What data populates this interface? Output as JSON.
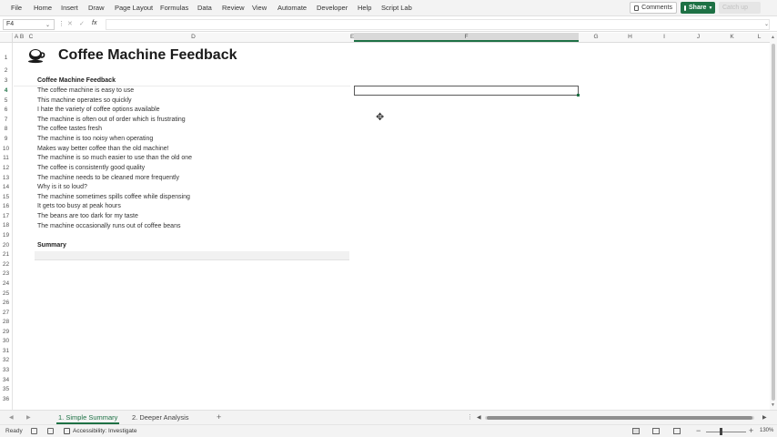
{
  "menu": [
    "File",
    "Home",
    "Insert",
    "Draw",
    "Page Layout",
    "Formulas",
    "Data",
    "Review",
    "View",
    "Automate",
    "Developer",
    "Help",
    "Script Lab"
  ],
  "toolbar": {
    "comments_label": "Comments",
    "share_label": "Share",
    "catchup_label": "Catch up"
  },
  "formula_bar": {
    "name_box": "F4",
    "fx_label": "fx",
    "value": ""
  },
  "columns": [
    "A",
    "B",
    "C",
    "D",
    "E",
    "F",
    "G",
    "H",
    "I",
    "J",
    "K",
    "L"
  ],
  "selected_column": "F",
  "rows": [
    "1",
    "2",
    "3",
    "4",
    "5",
    "6",
    "7",
    "8",
    "9",
    "10",
    "11",
    "12",
    "13",
    "14",
    "15",
    "16",
    "17",
    "18",
    "19",
    "20",
    "21",
    "22",
    "23",
    "24",
    "25",
    "26",
    "27",
    "28",
    "29",
    "30",
    "31",
    "32",
    "33",
    "34",
    "35",
    "36"
  ],
  "selected_row": "4",
  "sheet": {
    "title": "Coffee Machine Feedback",
    "section_heading": "Coffee Machine Feedback",
    "feedback": [
      "The coffee machine is easy to use",
      "This machine operates so quickly",
      "I hate the variety of coffee options available",
      "The machine is often out of order which is frustrating",
      "The coffee tastes fresh",
      "The machine is too noisy when operating",
      "Makes way better coffee than the old machine!",
      "The machine is so much easier to use than the old one",
      "The coffee is consistently good quality",
      "The machine needs to be cleaned more frequently",
      "Why is it so loud?",
      "The machine sometimes spills coffee while dispensing",
      "It gets too busy at peak hours",
      "The beans are too dark for my taste",
      "The machine occasionally runs out of coffee beans"
    ],
    "summary_heading": "Summary"
  },
  "tabs": [
    {
      "label": "1. Simple Summary",
      "active": true
    },
    {
      "label": "2. Deeper Analysis",
      "active": false
    }
  ],
  "status": {
    "ready": "Ready",
    "accessibility": "Accessibility: Investigate",
    "zoom": "130%"
  },
  "colors": {
    "accent": "#1e7145"
  }
}
